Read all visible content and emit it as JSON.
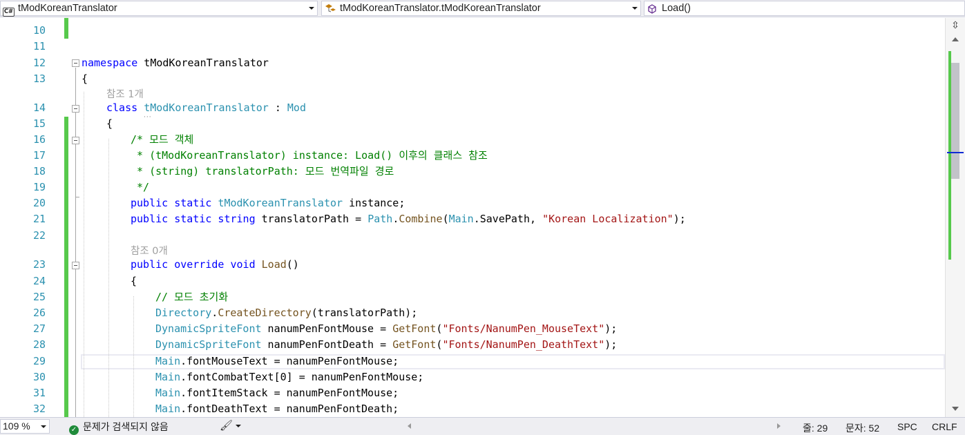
{
  "navbar": {
    "file_combo": "tModKoreanTranslator",
    "class_combo": "tModKoreanTranslator.tModKoreanTranslator",
    "member_combo": "Load()",
    "file_icon": "C#"
  },
  "editor": {
    "line_numbers": [
      "10",
      "11",
      "12",
      "13",
      "14",
      "15",
      "16",
      "17",
      "18",
      "19",
      "20",
      "21",
      "22",
      "23",
      "24",
      "25",
      "26",
      "27",
      "28",
      "29",
      "30",
      "31",
      "32"
    ],
    "codelens_1": "참조 1개",
    "codelens_2": "참조 0개",
    "lines": {
      "l12_kw": "namespace",
      "l12_name": " tModKoreanTranslator",
      "l13": "{",
      "l14_kw": "class",
      "l14_name": "tModKoreanTranslator",
      "l14_colon": " : ",
      "l14_base": "Mod",
      "l15": "{",
      "l16": "/* 모드 객체",
      "l17": " * (tModKoreanTranslator) instance: Load() 이후의 클래스 참조",
      "l18": " * (string) translatorPath: 모드 번역파일 경로",
      "l19": " */",
      "l20_kw": "public static",
      "l20_type": "tModKoreanTranslator",
      "l20_rest": " instance;",
      "l21_kw": "public static string",
      "l21_name": " translatorPath = ",
      "l21_type": "Path",
      "l21_dot": ".",
      "l21_method": "Combine",
      "l21_p1": "(",
      "l21_type2": "Main",
      "l21_arg": ".SavePath, ",
      "l21_str": "\"Korean Localization\"",
      "l21_end": ");",
      "l23_kw": "public override void",
      "l23_method": "Load",
      "l23_end": "()",
      "l24": "{",
      "l25": "// 모드 초기화",
      "l26_type": "Directory",
      "l26_dot": ".",
      "l26_method": "CreateDirectory",
      "l26_rest": "(translatorPath);",
      "l27_type": "DynamicSpriteFont",
      "l27_name": " nanumPenFontMouse = ",
      "l27_method": "GetFont",
      "l27_p": "(",
      "l27_str": "\"Fonts/NanumPen_MouseText\"",
      "l27_end": ");",
      "l28_type": "DynamicSpriteFont",
      "l28_name": " nanumPenFontDeath = ",
      "l28_method": "GetFont",
      "l28_p": "(",
      "l28_str": "\"Fonts/NanumPen_DeathText\"",
      "l28_end": ");",
      "l29_type": "Main",
      "l29_rest": ".fontMouseText = nanumPenFontMouse;",
      "l30_type": "Main",
      "l30_rest": ".fontCombatText[0] = nanumPenFontMouse;",
      "l31_type": "Main",
      "l31_rest": ".fontItemStack = nanumPenFontMouse;",
      "l32_type": "Main",
      "l32_rest": ".fontDeathText = nanumPenFontDeath;"
    }
  },
  "statusbar": {
    "zoom": "109 %",
    "issues": "문제가 검색되지 않음",
    "line": "줄: 29",
    "column": "문자: 52",
    "spc": "SPC",
    "crlf": "CRLF"
  },
  "colors": {
    "keyword": "#0000ff",
    "type": "#2b91af",
    "string": "#a31515",
    "comment": "#008000",
    "method": "#74531f",
    "change_marker": "#57c94c"
  }
}
